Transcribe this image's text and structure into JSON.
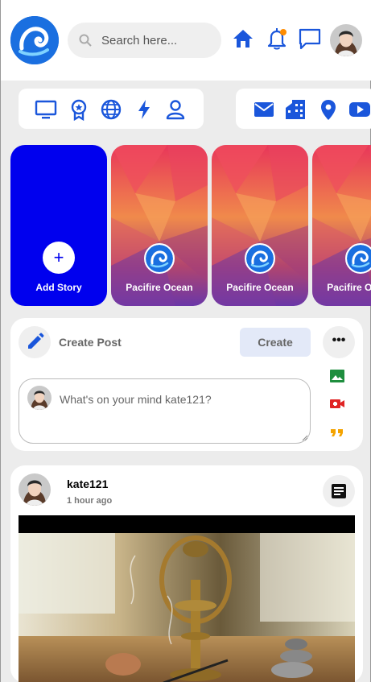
{
  "search": {
    "placeholder": "Search here..."
  },
  "header": {
    "icons": [
      "home-icon",
      "bell-icon",
      "chat-icon"
    ],
    "notification_dot_color": "#ff8c00",
    "accent_color": "#1a56db"
  },
  "stories": {
    "add_label": "Add Story",
    "items": [
      {
        "label": "Pacifire Ocean"
      },
      {
        "label": "Pacifire Ocean"
      },
      {
        "label": "Pacifire Ocean"
      }
    ]
  },
  "create_post": {
    "title": "Create Post",
    "button": "Create",
    "placeholder": "What's on your mind kate121?",
    "icons": [
      {
        "name": "image-icon",
        "color": "#1e8e3e"
      },
      {
        "name": "video-icon",
        "color": "#e02424"
      },
      {
        "name": "quote-icon",
        "color": "#f4a300"
      }
    ]
  },
  "post": {
    "username": "kate121",
    "time": "1 hour ago"
  }
}
